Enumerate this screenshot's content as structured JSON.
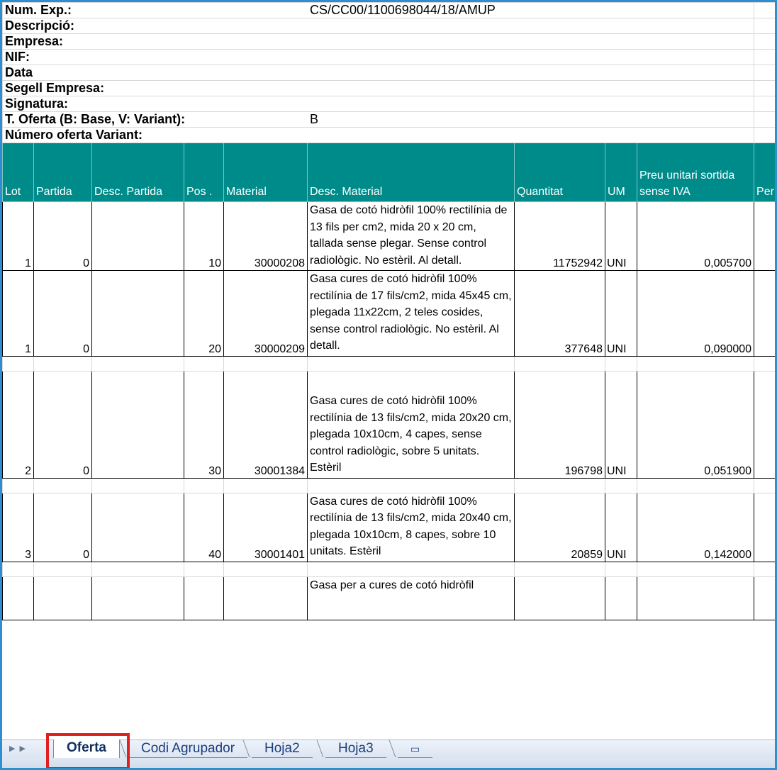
{
  "header": {
    "num_exp_label": "Num. Exp.:",
    "num_exp_value": "CS/CC00/1100698044/18/AMUP",
    "descripcio_label": "Descripció:",
    "empresa_label": "Empresa:",
    "nif_label": "NIF:",
    "data_label": "Data",
    "segell_label": "Segell Empresa:",
    "signatura_label": "Signatura:",
    "t_oferta_label": "T. Oferta (B: Base, V: Variant):",
    "t_oferta_value": "B",
    "numero_oferta_label": "Número oferta Variant:"
  },
  "table": {
    "columns": [
      "Lot",
      "Partida",
      "Desc. Partida",
      "Pos .",
      "Material",
      "Desc. Material",
      "Quantitat",
      "UM",
      "Preu unitari sortida sense IVA",
      "Per"
    ],
    "rows": [
      {
        "lot": "1",
        "partida": "0",
        "desc_partida": "",
        "pos": "10",
        "material": "30000208",
        "desc_material": "Gasa de cotó hidròfil 100% rectilínia de 13 fils per cm2, mida 20 x 20 cm,  tallada sense plegar. Sense control radiològic. No estèril. Al detall.",
        "quantitat": "11752942",
        "um": "UNI",
        "preu": "0,005700"
      },
      {
        "lot": "1",
        "partida": "0",
        "desc_partida": "",
        "pos": "20",
        "material": "30000209",
        "desc_material": "Gasa cures de cotó hidròfil 100% rectilínia de 17 fils/cm2, mida 45x45 cm, plegada 11x22cm, 2 teles cosides, sense control radiològic. No estèril. Al detall.",
        "quantitat": "377648",
        "um": "UNI",
        "preu": "0,090000"
      },
      {
        "lot": "2",
        "partida": "0",
        "desc_partida": "",
        "pos": "30",
        "material": "30001384",
        "desc_material": "Gasa cures de cotó hidròfil 100% rectilínia de 13 fils/cm2, mida 20x20 cm, plegada 10x10cm, 4 capes, sense control radiològic, sobre 5 unitats. Estèril",
        "quantitat": "196798",
        "um": "UNI",
        "preu": "0,051900"
      },
      {
        "lot": "3",
        "partida": "0",
        "desc_partida": "",
        "pos": "40",
        "material": "30001401",
        "desc_material": "Gasa cures de cotó hidròfil 100% rectilínia de 13 fils/cm2, mida 20x40 cm, plegada 10x10cm, 8 capes, sobre 10 unitats. Estèril",
        "quantitat": "20859",
        "um": "UNI",
        "preu": "0,142000"
      },
      {
        "desc_material": "Gasa per a cures de cotó hidròfil"
      }
    ]
  },
  "sheet_tabs": [
    "Oferta",
    "Codi Agrupador",
    "Hoja2",
    "Hoja3"
  ],
  "active_tab": "Oferta",
  "colors": {
    "header_fill": "#008b8b",
    "highlight": "#e02020",
    "frame": "#2d8fd0"
  }
}
